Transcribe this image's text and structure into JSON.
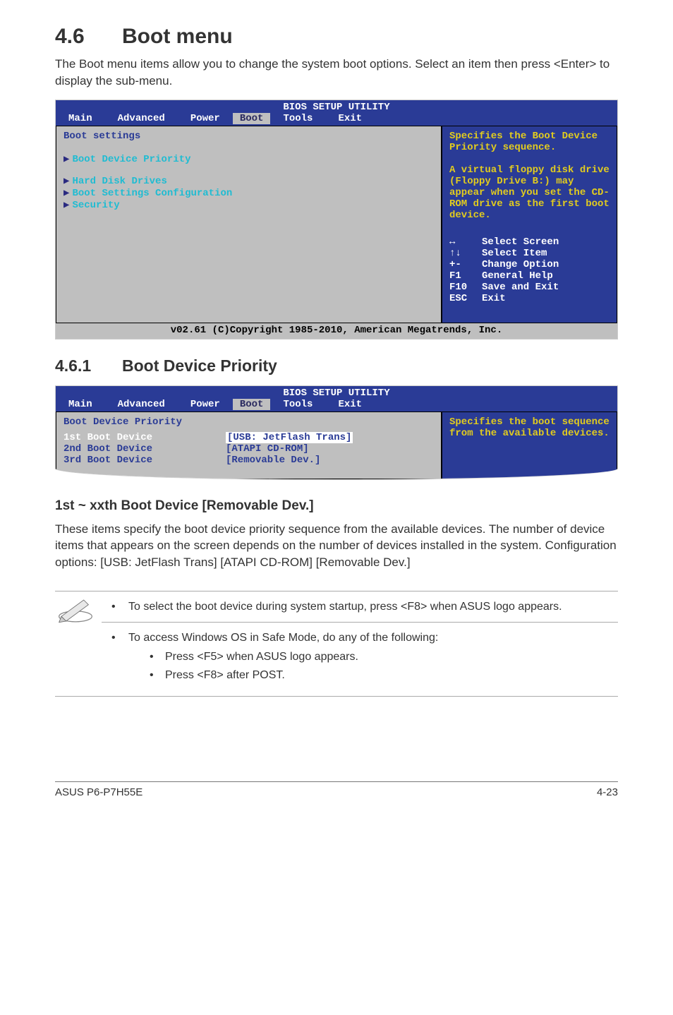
{
  "section": {
    "number": "4.6",
    "title": "Boot menu",
    "intro": "The Boot menu items allow you to change the system boot options. Select an item then press <Enter> to display the sub-menu."
  },
  "bios1": {
    "title": "BIOS SETUP UTILITY",
    "tabs": [
      "Main",
      "Advanced",
      "Power",
      "Boot",
      "Tools",
      "Exit"
    ],
    "active_tab": "Boot",
    "heading": "Boot settings",
    "items": [
      "Boot Device Priority",
      "Hard Disk Drives",
      "Boot Settings Configuration",
      "Security"
    ],
    "help": "Specifies the Boot Device Priority sequence.\n\nA virtual floppy disk drive (Floppy Drive B:) may appear when you set the CD-ROM drive as the first boot device.",
    "keys": [
      {
        "k": "↔",
        "d": "Select Screen"
      },
      {
        "k": "↑↓",
        "d": "Select Item"
      },
      {
        "k": "+-",
        "d": "Change Option"
      },
      {
        "k": "F1",
        "d": "General Help"
      },
      {
        "k": "F10",
        "d": "Save and Exit"
      },
      {
        "k": "ESC",
        "d": "Exit"
      }
    ],
    "footer": "v02.61 (C)Copyright 1985-2010, American Megatrends, Inc."
  },
  "subsection": {
    "number": "4.6.1",
    "title": "Boot Device Priority"
  },
  "bios2": {
    "title": "BIOS SETUP UTILITY",
    "tabs": [
      "Main",
      "Advanced",
      "Power",
      "Boot",
      "Tools",
      "Exit"
    ],
    "active_tab": "Boot",
    "heading": "Boot Device Priority",
    "rows": [
      {
        "label": "1st Boot Device",
        "value": "[USB: JetFlash Trans]",
        "selected": true
      },
      {
        "label": "2nd Boot Device",
        "value": "[ATAPI CD-ROM]",
        "selected": false
      },
      {
        "label": "3rd Boot Device",
        "value": "[Removable Dev.]",
        "selected": false
      }
    ],
    "help": "Specifies the boot sequence from the available devices."
  },
  "subsub": {
    "title": "1st ~ xxth Boot Device [Removable Dev.]",
    "body": "These items specify the boot device priority sequence from the available devices. The number of device items that appears on the screen depends on the number of devices installed in the system. Configuration options: [USB: JetFlash Trans] [ATAPI CD-ROM] [Removable Dev.]"
  },
  "note": {
    "items": [
      "To select the boot device during system startup, press <F8> when ASUS logo appears.",
      "To access Windows OS in Safe Mode, do any of the following:"
    ],
    "subitems": [
      "Press <F5> when ASUS logo appears.",
      "Press <F8> after POST."
    ]
  },
  "footer": {
    "left": "ASUS P6-P7H55E",
    "right": "4-23"
  }
}
